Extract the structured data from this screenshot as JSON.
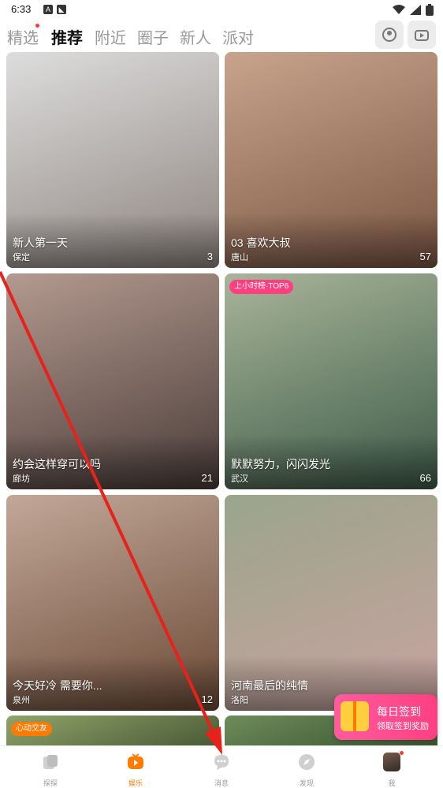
{
  "status": {
    "time": "6:33",
    "icons": [
      "A",
      "cat"
    ]
  },
  "tabs": [
    {
      "label": "精选"
    },
    {
      "label": "推荐"
    },
    {
      "label": "附近"
    },
    {
      "label": "圈子"
    },
    {
      "label": "新人"
    },
    {
      "label": "派对"
    }
  ],
  "cards": [
    {
      "title": "新人第一天",
      "location": "保定",
      "count": "3",
      "bg": "#b8a9a2"
    },
    {
      "title": "03 喜欢大叔",
      "location": "唐山",
      "count": "57",
      "bg": "#a47a64"
    },
    {
      "title": "约会这样穿可以吗",
      "location": "廊坊",
      "count": "21",
      "bg": "#6f5c55"
    },
    {
      "title": "默默努力，闪闪发光",
      "location": "武汉",
      "count": "66",
      "badge": "上小时榜·TOP6",
      "bg": "#5f7a62"
    },
    {
      "title": "今天好冷 需要你...",
      "location": "泉州",
      "count": "12",
      "bg": "#8d6a55"
    },
    {
      "title": "河南最后的纯情",
      "location": "洛阳",
      "count": "",
      "bg": "#7b6a5c"
    },
    {
      "badge": "心动交友",
      "bg": "#6e7f52"
    },
    {
      "bg": "#4f6a45"
    }
  ],
  "checkin": {
    "title": "每日签到",
    "subtitle": "领取签到奖励"
  },
  "nav": [
    {
      "label": "探探"
    },
    {
      "label": "娱乐"
    },
    {
      "label": "消息"
    },
    {
      "label": "发现"
    },
    {
      "label": "我"
    }
  ],
  "colors": {
    "accent": "#ff7a00",
    "arrow": "#e8211b",
    "badge_pink": "#ff3f80",
    "badge_orange": "#ff7a00"
  }
}
